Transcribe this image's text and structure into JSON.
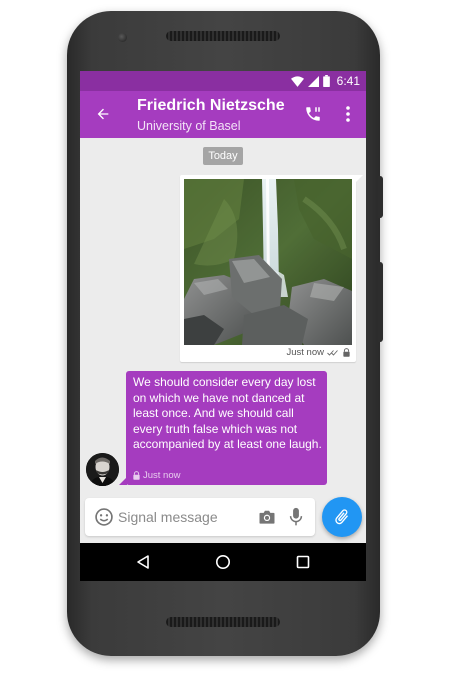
{
  "status_bar": {
    "time": "6:41",
    "icons": [
      "wifi-icon",
      "signal-icon",
      "battery-icon"
    ]
  },
  "toolbar": {
    "contact_name": "Friedrich Nietzsche",
    "contact_subtitle": "University of Basel",
    "icons": [
      "back-arrow-icon",
      "phone-call-icon",
      "more-vert-icon"
    ]
  },
  "conversation": {
    "date_divider": "Today",
    "messages": [
      {
        "type": "image",
        "direction": "outgoing",
        "image_subject": "waterfall",
        "timestamp": "Just now",
        "icons": [
          "double-check-icon",
          "lock-icon"
        ]
      },
      {
        "type": "text",
        "direction": "incoming",
        "text": "We should consider every day lost on which we have not danced at least once. And we should call every truth false which was not accompanied by at least one laugh.",
        "timestamp": "Just now",
        "icons": [
          "lock-icon"
        ]
      }
    ]
  },
  "composer": {
    "placeholder": "Signal message",
    "value": "",
    "icons": [
      "emoji-icon",
      "camera-icon",
      "mic-icon",
      "attachment-icon"
    ]
  },
  "nav_bar": {
    "icons": [
      "nav-back-icon",
      "nav-home-icon",
      "nav-recents-icon"
    ]
  },
  "colors": {
    "status_bar": "#8a2fa1",
    "toolbar": "#a53cbf",
    "incoming_bubble": "#a53cbf",
    "conversation_bg": "#ececec",
    "fab": "#2196f3"
  }
}
